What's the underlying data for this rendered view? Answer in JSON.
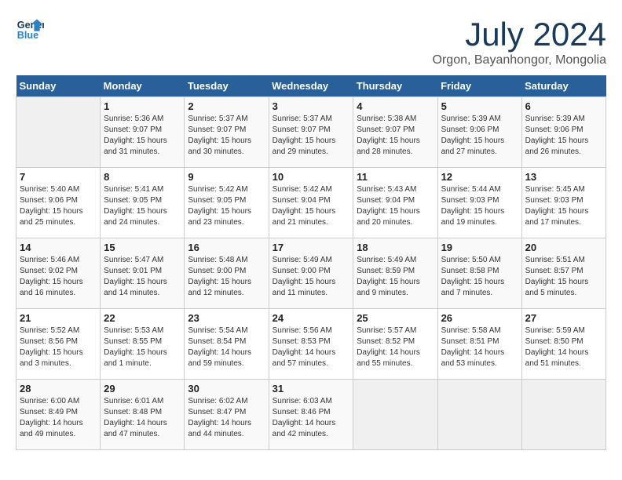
{
  "header": {
    "logo_line1": "General",
    "logo_line2": "Blue",
    "title": "July 2024",
    "subtitle": "Orgon, Bayanhongor, Mongolia"
  },
  "weekdays": [
    "Sunday",
    "Monday",
    "Tuesday",
    "Wednesday",
    "Thursday",
    "Friday",
    "Saturday"
  ],
  "weeks": [
    [
      {
        "day": "",
        "empty": true
      },
      {
        "day": "1",
        "sunrise": "Sunrise: 5:36 AM",
        "sunset": "Sunset: 9:07 PM",
        "daylight": "Daylight: 15 hours and 31 minutes."
      },
      {
        "day": "2",
        "sunrise": "Sunrise: 5:37 AM",
        "sunset": "Sunset: 9:07 PM",
        "daylight": "Daylight: 15 hours and 30 minutes."
      },
      {
        "day": "3",
        "sunrise": "Sunrise: 5:37 AM",
        "sunset": "Sunset: 9:07 PM",
        "daylight": "Daylight: 15 hours and 29 minutes."
      },
      {
        "day": "4",
        "sunrise": "Sunrise: 5:38 AM",
        "sunset": "Sunset: 9:07 PM",
        "daylight": "Daylight: 15 hours and 28 minutes."
      },
      {
        "day": "5",
        "sunrise": "Sunrise: 5:39 AM",
        "sunset": "Sunset: 9:06 PM",
        "daylight": "Daylight: 15 hours and 27 minutes."
      },
      {
        "day": "6",
        "sunrise": "Sunrise: 5:39 AM",
        "sunset": "Sunset: 9:06 PM",
        "daylight": "Daylight: 15 hours and 26 minutes."
      }
    ],
    [
      {
        "day": "7",
        "sunrise": "Sunrise: 5:40 AM",
        "sunset": "Sunset: 9:06 PM",
        "daylight": "Daylight: 15 hours and 25 minutes."
      },
      {
        "day": "8",
        "sunrise": "Sunrise: 5:41 AM",
        "sunset": "Sunset: 9:05 PM",
        "daylight": "Daylight: 15 hours and 24 minutes."
      },
      {
        "day": "9",
        "sunrise": "Sunrise: 5:42 AM",
        "sunset": "Sunset: 9:05 PM",
        "daylight": "Daylight: 15 hours and 23 minutes."
      },
      {
        "day": "10",
        "sunrise": "Sunrise: 5:42 AM",
        "sunset": "Sunset: 9:04 PM",
        "daylight": "Daylight: 15 hours and 21 minutes."
      },
      {
        "day": "11",
        "sunrise": "Sunrise: 5:43 AM",
        "sunset": "Sunset: 9:04 PM",
        "daylight": "Daylight: 15 hours and 20 minutes."
      },
      {
        "day": "12",
        "sunrise": "Sunrise: 5:44 AM",
        "sunset": "Sunset: 9:03 PM",
        "daylight": "Daylight: 15 hours and 19 minutes."
      },
      {
        "day": "13",
        "sunrise": "Sunrise: 5:45 AM",
        "sunset": "Sunset: 9:03 PM",
        "daylight": "Daylight: 15 hours and 17 minutes."
      }
    ],
    [
      {
        "day": "14",
        "sunrise": "Sunrise: 5:46 AM",
        "sunset": "Sunset: 9:02 PM",
        "daylight": "Daylight: 15 hours and 16 minutes."
      },
      {
        "day": "15",
        "sunrise": "Sunrise: 5:47 AM",
        "sunset": "Sunset: 9:01 PM",
        "daylight": "Daylight: 15 hours and 14 minutes."
      },
      {
        "day": "16",
        "sunrise": "Sunrise: 5:48 AM",
        "sunset": "Sunset: 9:00 PM",
        "daylight": "Daylight: 15 hours and 12 minutes."
      },
      {
        "day": "17",
        "sunrise": "Sunrise: 5:49 AM",
        "sunset": "Sunset: 9:00 PM",
        "daylight": "Daylight: 15 hours and 11 minutes."
      },
      {
        "day": "18",
        "sunrise": "Sunrise: 5:49 AM",
        "sunset": "Sunset: 8:59 PM",
        "daylight": "Daylight: 15 hours and 9 minutes."
      },
      {
        "day": "19",
        "sunrise": "Sunrise: 5:50 AM",
        "sunset": "Sunset: 8:58 PM",
        "daylight": "Daylight: 15 hours and 7 minutes."
      },
      {
        "day": "20",
        "sunrise": "Sunrise: 5:51 AM",
        "sunset": "Sunset: 8:57 PM",
        "daylight": "Daylight: 15 hours and 5 minutes."
      }
    ],
    [
      {
        "day": "21",
        "sunrise": "Sunrise: 5:52 AM",
        "sunset": "Sunset: 8:56 PM",
        "daylight": "Daylight: 15 hours and 3 minutes."
      },
      {
        "day": "22",
        "sunrise": "Sunrise: 5:53 AM",
        "sunset": "Sunset: 8:55 PM",
        "daylight": "Daylight: 15 hours and 1 minute."
      },
      {
        "day": "23",
        "sunrise": "Sunrise: 5:54 AM",
        "sunset": "Sunset: 8:54 PM",
        "daylight": "Daylight: 14 hours and 59 minutes."
      },
      {
        "day": "24",
        "sunrise": "Sunrise: 5:56 AM",
        "sunset": "Sunset: 8:53 PM",
        "daylight": "Daylight: 14 hours and 57 minutes."
      },
      {
        "day": "25",
        "sunrise": "Sunrise: 5:57 AM",
        "sunset": "Sunset: 8:52 PM",
        "daylight": "Daylight: 14 hours and 55 minutes."
      },
      {
        "day": "26",
        "sunrise": "Sunrise: 5:58 AM",
        "sunset": "Sunset: 8:51 PM",
        "daylight": "Daylight: 14 hours and 53 minutes."
      },
      {
        "day": "27",
        "sunrise": "Sunrise: 5:59 AM",
        "sunset": "Sunset: 8:50 PM",
        "daylight": "Daylight: 14 hours and 51 minutes."
      }
    ],
    [
      {
        "day": "28",
        "sunrise": "Sunrise: 6:00 AM",
        "sunset": "Sunset: 8:49 PM",
        "daylight": "Daylight: 14 hours and 49 minutes."
      },
      {
        "day": "29",
        "sunrise": "Sunrise: 6:01 AM",
        "sunset": "Sunset: 8:48 PM",
        "daylight": "Daylight: 14 hours and 47 minutes."
      },
      {
        "day": "30",
        "sunrise": "Sunrise: 6:02 AM",
        "sunset": "Sunset: 8:47 PM",
        "daylight": "Daylight: 14 hours and 44 minutes."
      },
      {
        "day": "31",
        "sunrise": "Sunrise: 6:03 AM",
        "sunset": "Sunset: 8:46 PM",
        "daylight": "Daylight: 14 hours and 42 minutes."
      },
      {
        "day": "",
        "empty": true
      },
      {
        "day": "",
        "empty": true
      },
      {
        "day": "",
        "empty": true
      }
    ]
  ]
}
